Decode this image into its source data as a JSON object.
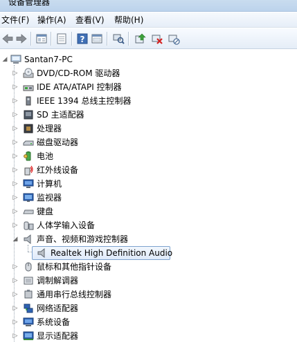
{
  "window": {
    "title": "设备管理器"
  },
  "menu": [
    {
      "label": "文件(F)"
    },
    {
      "label": "操作(A)"
    },
    {
      "label": "查看(V)"
    },
    {
      "label": "帮助(H)"
    }
  ],
  "toolbar": {
    "icons": [
      "back-icon",
      "forward-icon",
      "properties-icon",
      "show-hide-icon",
      "help-icon",
      "show-hidden-icon",
      "scan-hardware-icon",
      "update-driver-icon",
      "uninstall-icon",
      "disable-icon"
    ]
  },
  "tree": {
    "root": {
      "label": "Santan7-PC",
      "icon": "computer-icon"
    },
    "categories": [
      {
        "label": "DVD/CD-ROM 驱动器",
        "icon": "dvd-drive-icon"
      },
      {
        "label": "IDE ATA/ATAPI 控制器",
        "icon": "ide-controller-icon"
      },
      {
        "label": "IEEE 1394 总线主控制器",
        "icon": "ieee1394-icon"
      },
      {
        "label": "SD 主适配器",
        "icon": "sd-adapter-icon"
      },
      {
        "label": "处理器",
        "icon": "processor-icon"
      },
      {
        "label": "磁盘驱动器",
        "icon": "disk-drive-icon"
      },
      {
        "label": "电池",
        "icon": "battery-icon"
      },
      {
        "label": "红外线设备",
        "icon": "infrared-icon"
      },
      {
        "label": "计算机",
        "icon": "computer-icon"
      },
      {
        "label": "监视器",
        "icon": "monitor-icon"
      },
      {
        "label": "键盘",
        "icon": "keyboard-icon"
      },
      {
        "label": "人体学输入设备",
        "icon": "hid-icon"
      },
      {
        "label": "声音、视频和游戏控制器",
        "icon": "speaker-icon",
        "expanded": true
      },
      {
        "label": "Realtek High Definition Audio",
        "icon": "speaker-icon",
        "child": true,
        "selected": true
      },
      {
        "label": "鼠标和其他指针设备",
        "icon": "mouse-icon"
      },
      {
        "label": "调制解调器",
        "icon": "modem-icon"
      },
      {
        "label": "通用串行总线控制器",
        "icon": "usb-icon"
      },
      {
        "label": "网络适配器",
        "icon": "network-adapter-icon"
      },
      {
        "label": "系统设备",
        "icon": "system-device-icon"
      },
      {
        "label": "显示适配器",
        "icon": "display-adapter-icon"
      }
    ]
  },
  "colors": {
    "selection_border": "#7da2ce",
    "selection_fill": "#dfeafa"
  }
}
